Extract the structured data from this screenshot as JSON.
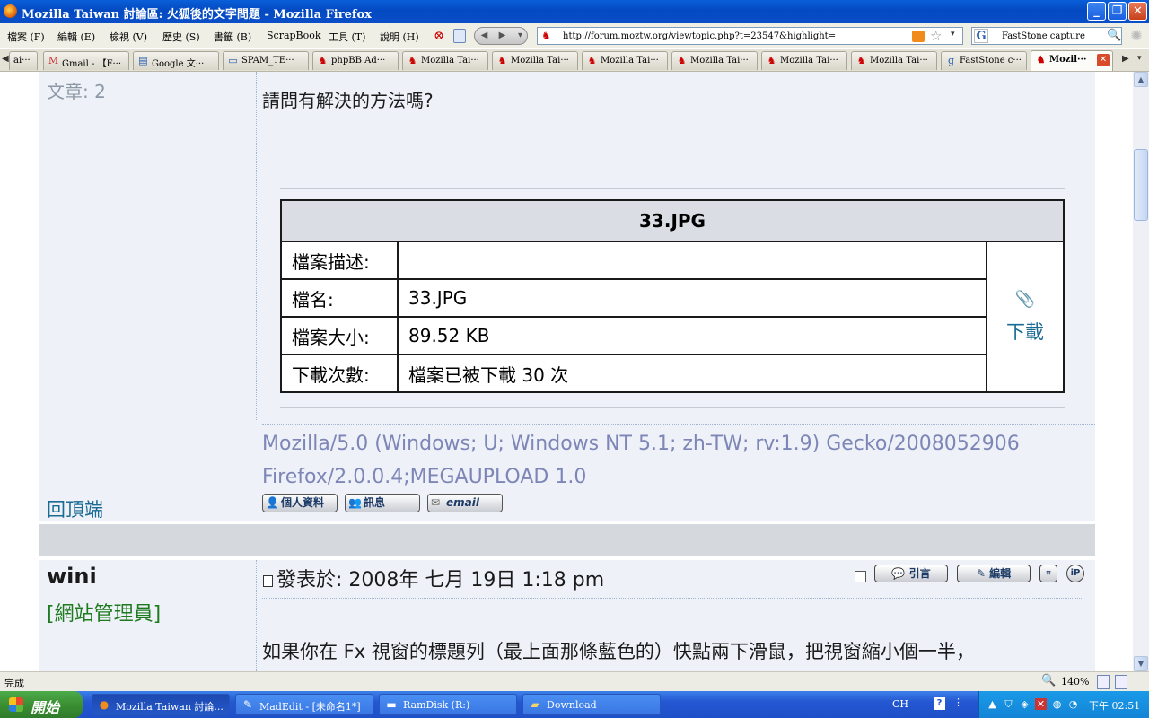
{
  "window": {
    "title": "Mozilla Taiwan 討論區: 火狐後的文字問題 - Mozilla Firefox"
  },
  "menu": {
    "items": [
      "檔案 (F)",
      "編輯 (E)",
      "檢視 (V)",
      "歷史 (S)",
      "書籤 (B)",
      "ScrapBook",
      "工具 (T)",
      "說明 (H)"
    ]
  },
  "urlbar": {
    "value": "http://forum.moztw.org/viewtopic.php?t=23547&highlight="
  },
  "search": {
    "value": "FastStone capture",
    "engine": "G"
  },
  "tabs": [
    {
      "label": "ai···",
      "icon": "page-icon"
    },
    {
      "label": "Gmail - 【F···",
      "icon": "gmail-icon"
    },
    {
      "label": "Google 文···",
      "icon": "google-docs-icon"
    },
    {
      "label": "SPAM_TE···",
      "icon": "page-icon"
    },
    {
      "label": "phpBB Ad···",
      "icon": "firefox-icon"
    },
    {
      "label": "Mozilla Tai···",
      "icon": "firefox-icon"
    },
    {
      "label": "Mozilla Tai···",
      "icon": "firefox-icon"
    },
    {
      "label": "Mozilla Tai···",
      "icon": "firefox-icon"
    },
    {
      "label": "Mozilla Tai···",
      "icon": "firefox-icon"
    },
    {
      "label": "Mozilla Tai···",
      "icon": "firefox-icon"
    },
    {
      "label": "Mozilla Tai···",
      "icon": "firefox-icon"
    },
    {
      "label": "FastStone c···",
      "icon": "google-icon"
    },
    {
      "label": "Mozil···",
      "icon": "firefox-icon",
      "active": true
    }
  ],
  "post1": {
    "post_count": "文章: 2",
    "text": "請問有解決的方法嗎?",
    "attachment": {
      "header": "33.JPG",
      "rows": [
        {
          "label": "檔案描述:",
          "value": ""
        },
        {
          "label": "檔名:",
          "value": "33.JPG"
        },
        {
          "label": "檔案大小:",
          "value": "89.52 KB"
        },
        {
          "label": "下載次數:",
          "value": "檔案已被下載 30 次"
        }
      ],
      "download": "下載"
    },
    "signature": "Mozilla/5.0 (Windows; U; Windows NT 5.1; zh-TW; rv:1.9) Gecko/2008052906 Firefox/2.0.0.4;MEGAUPLOAD 1.0",
    "back_to_top": "回頂端",
    "buttons": {
      "profile": "個人資料",
      "pm": "訊息",
      "email": "email"
    }
  },
  "post2": {
    "author": "wini",
    "rank": "[網站管理員]",
    "date": "發表於: 2008年 七月 19日 1:18 pm",
    "buttons": {
      "quote": "引言",
      "edit": "編輯",
      "ip": "iP"
    },
    "text": "如果你在 Fx 視窗的標題列（最上面那條藍色的）快點兩下滑鼠，把視窗縮小個一半，"
  },
  "status": {
    "text": "完成",
    "zoom": "140%"
  },
  "taskbar": {
    "start": "開始",
    "tasks": [
      {
        "label": "Mozilla Taiwan 討論...",
        "icon": "firefox-icon",
        "active": true
      },
      {
        "label": "MadEdit - [未命名1*]",
        "icon": "editor-icon"
      },
      {
        "label": "RamDisk (R:)",
        "icon": "drive-icon"
      },
      {
        "label": "Download",
        "icon": "folder-icon"
      }
    ],
    "lang": "CH",
    "clock": "下午 02:51"
  }
}
